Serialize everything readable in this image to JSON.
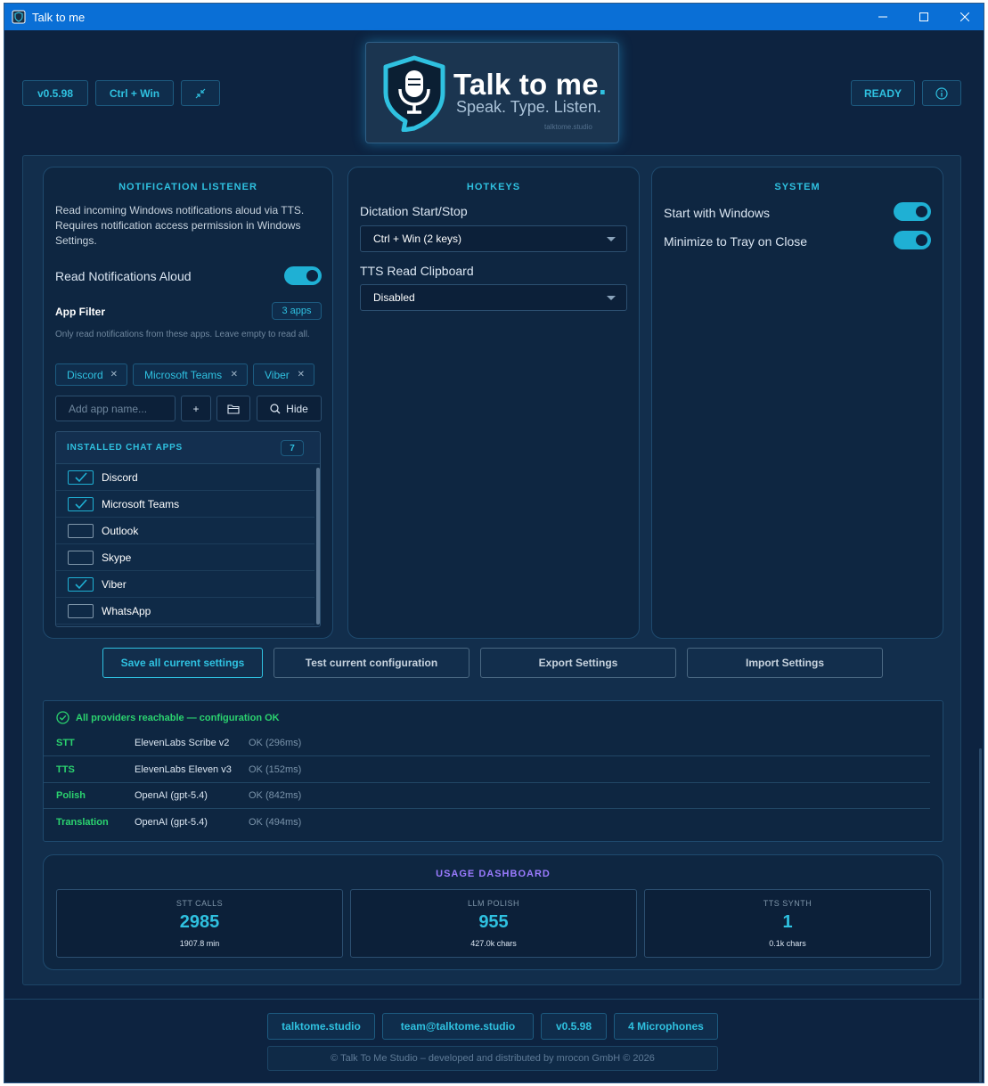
{
  "window": {
    "title": "Talk to me"
  },
  "header": {
    "version_chip": "v0.5.98",
    "hotkey_chip": "Ctrl + Win",
    "status_chip": "READY",
    "logo": {
      "title": "Talk to me",
      "title_dot": ".",
      "tagline": "Speak. Type. Listen.",
      "site": "talktome.studio"
    }
  },
  "notification": {
    "title": "NOTIFICATION LISTENER",
    "description": "Read incoming Windows notifications aloud via TTS. Requires notification access permission in Windows Settings.",
    "read_aloud_label": "Read Notifications Aloud",
    "read_aloud_on": true,
    "app_filter_label": "App Filter",
    "app_count_badge": "3 apps",
    "filter_hint": "Only read notifications from these apps. Leave empty to read all.",
    "tags": [
      "Discord",
      "Microsoft Teams",
      "Viber"
    ],
    "add_placeholder": "Add app name...",
    "add_button": "+",
    "hide_button": "Hide",
    "installed_title": "INSTALLED CHAT APPS",
    "installed_count": "7",
    "apps": [
      {
        "name": "Discord",
        "checked": true
      },
      {
        "name": "Microsoft Teams",
        "checked": true
      },
      {
        "name": "Outlook",
        "checked": false
      },
      {
        "name": "Skype",
        "checked": false
      },
      {
        "name": "Viber",
        "checked": true
      },
      {
        "name": "WhatsApp",
        "checked": false
      }
    ]
  },
  "hotkeys": {
    "title": "HOTKEYS",
    "dictation_label": "Dictation Start/Stop",
    "dictation_value": "Ctrl + Win (2 keys)",
    "tts_label": "TTS Read Clipboard",
    "tts_value": "Disabled"
  },
  "system": {
    "title": "SYSTEM",
    "start_with_windows": "Start with Windows",
    "minimize_to_tray": "Minimize to Tray on Close"
  },
  "actions": {
    "save": "Save all current settings",
    "test": "Test current configuration",
    "export": "Export Settings",
    "import": "Import Settings"
  },
  "status": {
    "headline": "All providers reachable — configuration OK",
    "rows": [
      {
        "key": "STT",
        "provider": "ElevenLabs Scribe v2",
        "result": "OK (296ms)"
      },
      {
        "key": "TTS",
        "provider": "ElevenLabs Eleven v3",
        "result": "OK (152ms)"
      },
      {
        "key": "Polish",
        "provider": "OpenAI (gpt-5.4)",
        "result": "OK (842ms)"
      },
      {
        "key": "Translation",
        "provider": "OpenAI (gpt-5.4)",
        "result": "OK (494ms)"
      }
    ]
  },
  "usage": {
    "title": "USAGE DASHBOARD",
    "stats": [
      {
        "label": "STT CALLS",
        "value": "2985",
        "sub": "1907.8 min"
      },
      {
        "label": "LLM POLISH",
        "value": "955",
        "sub": "427.0k chars"
      },
      {
        "label": "TTS SYNTH",
        "value": "1",
        "sub": "0.1k chars"
      }
    ]
  },
  "footer": {
    "site": "talktome.studio",
    "email": "team@talktome.studio",
    "version": "v0.5.98",
    "microphones": "4 Microphones",
    "copyright": "© Talk To Me Studio – developed and distributed by mrocon GmbH © 2026"
  },
  "colors": {
    "accent": "#2fc1e0",
    "ok": "#2bd36f",
    "usage_title": "#9b7bff",
    "titlebar": "#0a6fd6"
  }
}
